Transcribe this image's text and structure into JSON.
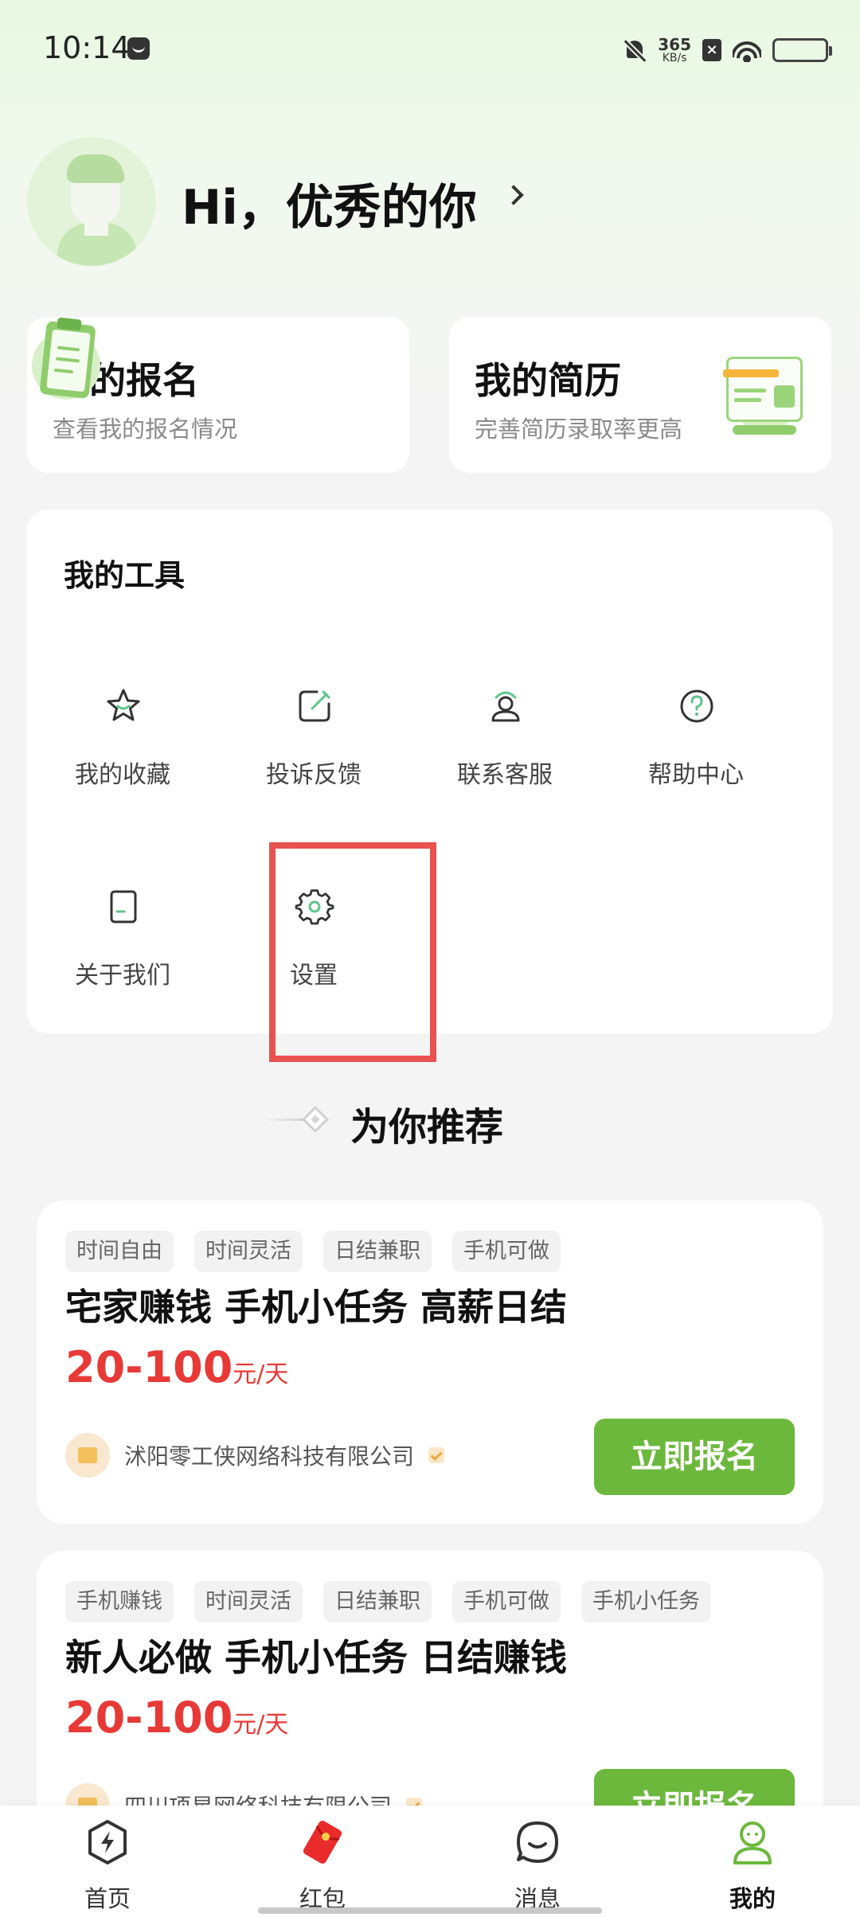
{
  "status_bar": {
    "time": "10:14",
    "net_speed_value": "365",
    "net_speed_unit": "KB/s"
  },
  "profile": {
    "greeting": "Hi，优秀的你"
  },
  "feature_cards": [
    {
      "title": "我的报名",
      "subtitle": "查看我的报名情况",
      "icon": "clipboard-icon"
    },
    {
      "title": "我的简历",
      "subtitle": "完善简历录取率更高",
      "icon": "resume-icon"
    }
  ],
  "tools": {
    "title": "我的工具",
    "items": [
      {
        "label": "我的收藏",
        "icon": "star-icon"
      },
      {
        "label": "投诉反馈",
        "icon": "edit-icon"
      },
      {
        "label": "联系客服",
        "icon": "customer-service-icon"
      },
      {
        "label": "帮助中心",
        "icon": "help-icon"
      },
      {
        "label": "关于我们",
        "icon": "document-icon"
      },
      {
        "label": "设置",
        "icon": "gear-icon"
      }
    ]
  },
  "recommend": {
    "title": "为你推荐"
  },
  "jobs": [
    {
      "tags": [
        "时间自由",
        "时间灵活",
        "日结兼职",
        "手机可做"
      ],
      "title": "宅家赚钱 手机小任务 高薪日结",
      "salary": "20-100",
      "salary_unit": "元/天",
      "company": "沭阳零工侠网络科技有限公司",
      "button": "立即报名"
    },
    {
      "tags": [
        "手机赚钱",
        "时间灵活",
        "日结兼职",
        "手机可做",
        "手机小任务"
      ],
      "title": "新人必做 手机小任务 日结赚钱",
      "salary": "20-100",
      "salary_unit": "元/天",
      "company": "四川项星网络科技有限公司",
      "button": "立即报名"
    }
  ],
  "bottom_nav": [
    {
      "label": "首页",
      "icon": "lightning-icon"
    },
    {
      "label": "红包",
      "icon": "red-envelope-icon"
    },
    {
      "label": "消息",
      "icon": "message-icon"
    },
    {
      "label": "我的",
      "icon": "profile-icon",
      "active": true
    }
  ],
  "colors": {
    "accent_green": "#6cb83c",
    "salary_red": "#e73a37",
    "highlight_red": "#e8524f"
  }
}
